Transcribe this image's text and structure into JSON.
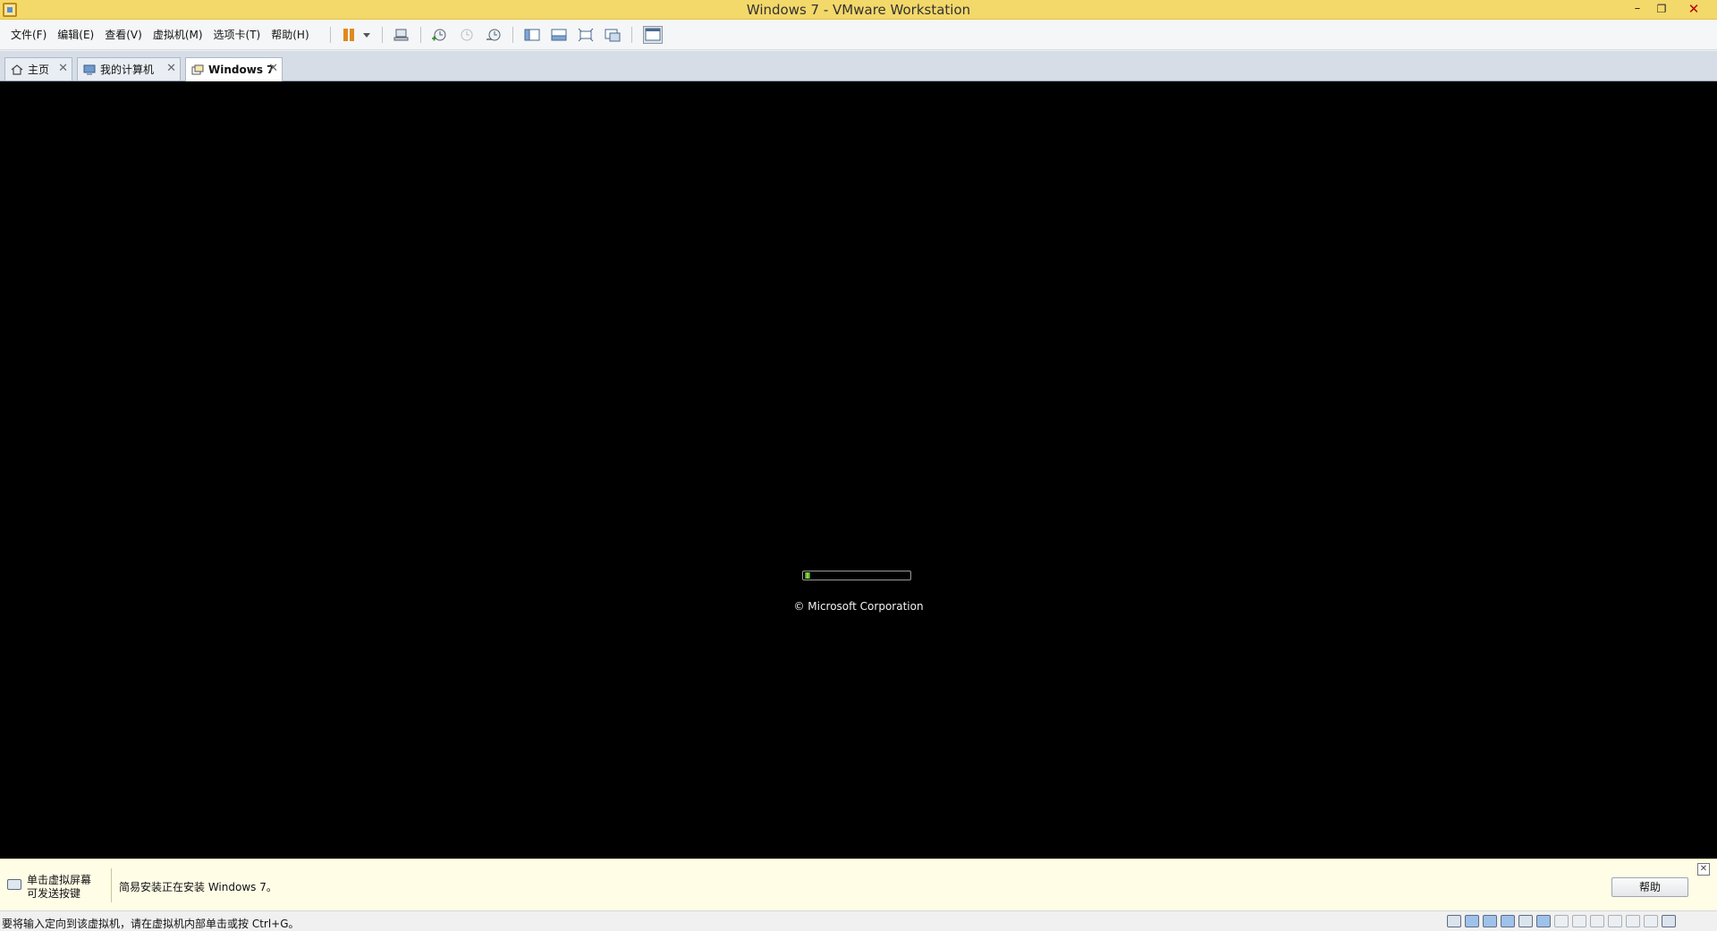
{
  "window": {
    "title": "Windows 7 - VMware Workstation",
    "minimize": "–",
    "restore": "❐",
    "close": "✕"
  },
  "menu": {
    "items": [
      "文件(F)",
      "编辑(E)",
      "查看(V)",
      "虚拟机(M)",
      "选项卡(T)",
      "帮助(H)"
    ]
  },
  "toolbar": {
    "icons": [
      "pause-icon",
      "send-ctrl-alt-del-icon",
      "snapshot-take-icon",
      "snapshot-revert-icon",
      "snapshot-manager-icon",
      "show-library-icon",
      "thumbnail-bar-icon",
      "full-screen-icon",
      "unity-icon",
      "console-view-icon"
    ]
  },
  "tabs": [
    {
      "label": "主页",
      "icon": "home-icon",
      "close": "✕",
      "active": false
    },
    {
      "label": "我的计算机",
      "icon": "computer-icon",
      "close": "✕",
      "active": false
    },
    {
      "label": "Windows 7",
      "icon": "vm-icon",
      "close": "✕",
      "active": true
    }
  ],
  "vm": {
    "copyright": "© Microsoft Corporation",
    "boot_progress": 0.05
  },
  "notification": {
    "hint_line1": "单击虚拟屏幕",
    "hint_line2": "可发送按键",
    "message": "简易安装正在安装 Windows 7。",
    "help_button": "帮助",
    "close": "✕"
  },
  "statusbar": {
    "text": "要将输入定向到该虚拟机，请在虚拟机内部单击或按 Ctrl+G。",
    "device_icons": [
      "hard-disk-icon",
      "cd-dvd-icon",
      "floppy-icon",
      "network-icon",
      "printer-icon",
      "sound-icon",
      "usb-icon",
      "usb-icon-2",
      "usb-icon-3",
      "usb-icon-4",
      "usb-icon-5",
      "usb-icon-6",
      "message-icon"
    ]
  },
  "colors": {
    "titlebar": "#f3d86a",
    "vm_background": "#000000",
    "notification_bg": "#fffde6",
    "pause_accent": "#e08a1e",
    "progress_green": "#9fe04a"
  }
}
